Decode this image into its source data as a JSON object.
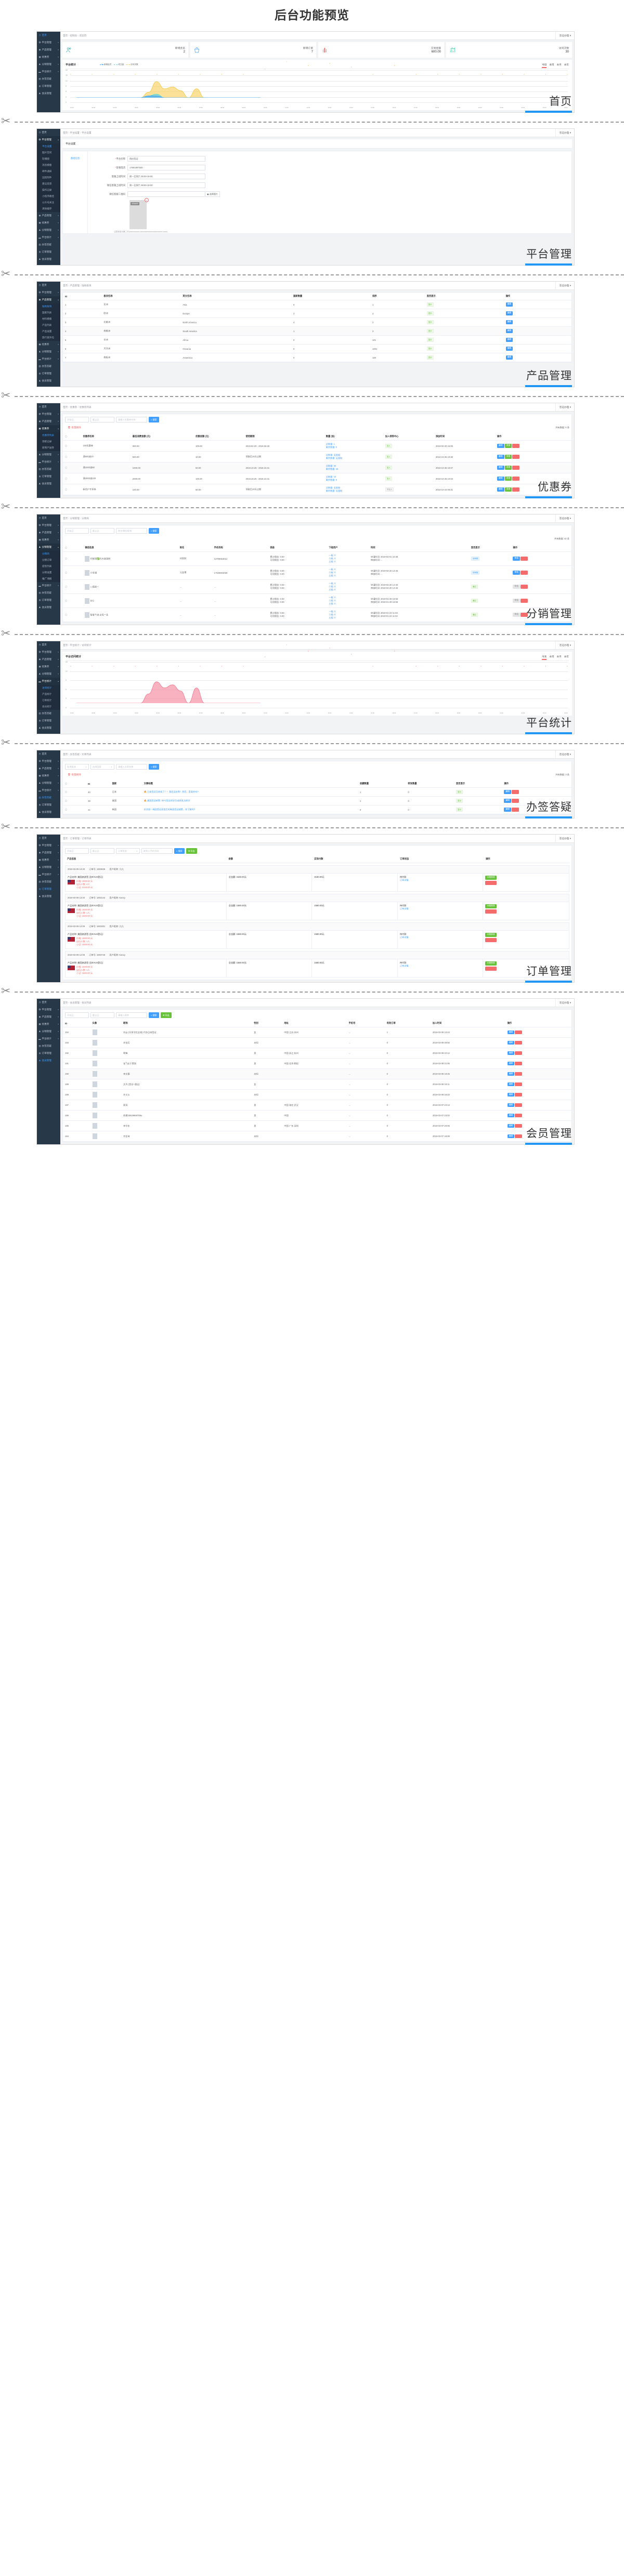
{
  "page": {
    "title": "后台功能预览"
  },
  "common": {
    "user_menu": "签证办理",
    "sidebar": [
      {
        "label": "首页",
        "icon": "dashboard-icon",
        "caret": ""
      },
      {
        "label": "平台管理",
        "icon": "gear-icon",
        "caret": "▾"
      },
      {
        "label": "产品管理",
        "icon": "globe-icon",
        "caret": "▾"
      },
      {
        "label": "优惠券",
        "icon": "ticket-icon",
        "caret": "▾"
      },
      {
        "label": "分销管理",
        "icon": "share-icon",
        "caret": "▾"
      },
      {
        "label": "平台统计",
        "icon": "monitor-icon",
        "caret": "▾"
      },
      {
        "label": "办签答疑",
        "icon": "book-icon",
        "caret": ""
      },
      {
        "label": "订单管理",
        "icon": "order-icon",
        "caret": ""
      },
      {
        "label": "会员管理",
        "icon": "user-icon",
        "caret": ""
      }
    ],
    "search_label": "搜索",
    "export_label": "导出",
    "edit_label": "编辑",
    "delete_label": "删除",
    "show_label": "显示",
    "start_date_ph": "开始日",
    "end_date_ph": "截止日"
  },
  "panels": [
    {
      "caption": "首页",
      "breadcrumb": [
        "首页",
        "控制台",
        "欢迎页"
      ],
      "stats": [
        {
          "label": "新增会员",
          "value": "2",
          "icon": "users-icon",
          "color": "#2bb7b3"
        },
        {
          "label": "新增订单",
          "value": "7",
          "icon": "bag-icon",
          "color": "#409eff"
        },
        {
          "label": "交易金额",
          "value": "600.00",
          "icon": "money-icon",
          "color": "#f56c6c"
        },
        {
          "label": "访问次数",
          "value": "30",
          "icon": "chart-up-icon",
          "color": "#2ecc9b"
        }
      ],
      "chart_title": "平台统计",
      "legend": [
        {
          "name": "新增会员",
          "color": "#409eff"
        },
        {
          "name": "成交量",
          "color": "#45d7e8"
        },
        {
          "name": "访问次数",
          "color": "#f5c842"
        }
      ],
      "tabs": [
        "今日",
        "本周",
        "本月",
        "本年"
      ],
      "active_tab": "今日"
    },
    {
      "caption": "平台管理",
      "breadcrumb": [
        "首页",
        "平台设置",
        "平台设置"
      ],
      "submenu": [
        "平台设置",
        "图片空间",
        "轮播图",
        "消息模版",
        "邮件通知",
        "远程附件",
        "建议反馈",
        "操作记录",
        "小程序路径",
        "公众号关注",
        "清除缓存"
      ],
      "submenu_selected": "平台设置",
      "card_title": "平台设置",
      "form_tab": "基础信息",
      "fields": [
        {
          "label": "平台名称",
          "value": "鸽应签证",
          "required": true
        },
        {
          "label": "客服电话",
          "value": "17681897500",
          "required": true
        },
        {
          "label": "客服上班时间",
          "value": "周一至周六 09:00-19:00",
          "required": false
        },
        {
          "label": "微信客服上班时间",
          "value": "周一至周六 09:00-19:00",
          "required": false
        },
        {
          "label": "微信客服二维码",
          "value": "",
          "required": false,
          "picker": "选择图片"
        }
      ],
      "thumb_size": "400x600",
      "hint": "注意状态为第二行(xxxxxxxxxxx.xxxxxxxxxxxxxxxxxxxxxxxx.com)"
    },
    {
      "caption": "产品管理",
      "breadcrumb": [
        "首页",
        "产品管理",
        "陆地板块"
      ],
      "submenu": [
        "陆地板块",
        "国家列表",
        "材料模版",
        "产品列表",
        "产品设置",
        "旅行意外险"
      ],
      "submenu_selected": "陆地板块",
      "columns": [
        "ID",
        "板块名称",
        "英文名称",
        "国家数量",
        "排序",
        "显否显示",
        "操作"
      ],
      "rows": [
        {
          "id": "1",
          "name": "亚洲",
          "en": "Asia",
          "count": "6",
          "sort": "1",
          "show": "显示",
          "action": "编辑"
        },
        {
          "id": "2",
          "name": "欧洲",
          "en": "Europe",
          "count": "3",
          "sort": "4",
          "show": "显示",
          "action": "编辑"
        },
        {
          "id": "3",
          "name": "北美洲",
          "en": "North America",
          "count": "4",
          "sort": "2",
          "show": "显示",
          "action": "编辑"
        },
        {
          "id": "4",
          "name": "南美洲",
          "en": "South America",
          "count": "1",
          "sort": "3",
          "show": "显示",
          "action": "编辑"
        },
        {
          "id": "5",
          "name": "非洲",
          "en": "Africa",
          "count": "0",
          "sort": "101",
          "show": "显示",
          "action": "编辑"
        },
        {
          "id": "6",
          "name": "大洋洲",
          "en": "Oceania",
          "count": "0",
          "sort": "1001",
          "show": "显示",
          "action": "编辑"
        },
        {
          "id": "7",
          "name": "南极洲",
          "en": "Antarctica",
          "count": "0",
          "sort": "100",
          "show": "显示",
          "action": "编辑"
        }
      ]
    },
    {
      "caption": "优惠券",
      "breadcrumb": [
        "首页",
        "优惠券",
        "优惠券列表"
      ],
      "submenu": [
        "优惠券列表",
        "领取记录",
        "新用户送券"
      ],
      "submenu_selected": "优惠券列表",
      "search_ph": "请输入优惠券名称",
      "batch_delete": "批量删除",
      "add": "添加",
      "count_text": "共有数据: 5 条",
      "columns": [
        "",
        "优惠券名称",
        "最低消费金额 (元)",
        "优惠金额 (元)",
        "使用期限",
        "数量 (张)",
        "加入领券中心",
        "添加时间",
        "操作"
      ],
      "rows": [
        {
          "name": "100优惠券",
          "min": "300.00",
          "amt": "100.00",
          "period": "2019.02.20 - 2019.02.28",
          "total": "总数量: 1",
          "left": "剩余数量: 0",
          "center": "加入",
          "center_type": "green",
          "time": "2019-02-20 15:06"
        },
        {
          "name": "满500减10",
          "min": "500.00",
          "amt": "10.00",
          "period": "领取后15天过期",
          "total": "总数量: 无限制",
          "left": "剩余数量: 无限制",
          "center": "加入",
          "center_type": "green",
          "time": "2018-10-25 10:38"
        },
        {
          "name": "满1000减50",
          "min": "1000.00",
          "amt": "50.00",
          "period": "2018.10.25 - 2018.10.31",
          "total": "总数量: 50",
          "left": "剩余数量: 46",
          "center": "加入",
          "center_type": "green",
          "time": "2018-10-25 10:37"
        },
        {
          "name": "满2000减100",
          "min": "2000.00",
          "amt": "100.00",
          "period": "2018.10.25 - 2018.10.31",
          "total": "总数量: 10",
          "left": "剩余数量: 9",
          "center": "加入",
          "center_type": "green",
          "time": "2018-10-25 10:03"
        },
        {
          "name": "新用户专享券",
          "min": "100.00",
          "amt": "50.00",
          "period": "领取后10天过期",
          "total": "总数量: 无限制",
          "left": "剩余数量: 无限制",
          "center": "不加入",
          "center_type": "grey",
          "time": "2018-10-24 09:31"
        }
      ],
      "actions": [
        "编辑",
        "发放",
        "删除"
      ]
    },
    {
      "caption": "分销管理",
      "breadcrumb": [
        "首页",
        "分销管理",
        "分销商"
      ],
      "submenu": [
        "分销商",
        "分销订单",
        "提现列表",
        "分销设置",
        "推广海报"
      ],
      "submenu_selected": "分销商",
      "search_ph": "姓名/微信昵称",
      "batch_pass": "批量通过",
      "count_text": "共有数据: 42 条",
      "columns": [
        "",
        "微信信息",
        "姓名",
        "手机号码",
        "佣金",
        "下级用户",
        "时间",
        "显否显示",
        "操作"
      ],
      "rows": [
        {
          "wx": "印家财✅光大旅游网",
          "name": "印家财",
          "phone": "13705915012",
          "c1": "累计佣金: 0.00",
          "c2": "可用佣金: 0.00",
          "l1": "一级: 0",
          "l2": "二级: 0",
          "l3": "三级: 0",
          "t1": "申请时间: 2019-03-01 22:38",
          "t2": "审核时间: ...",
          "status": "待审核",
          "status_type": "blue",
          "a1": "审核",
          "a1_type": "blue"
        },
        {
          "wx": "小幸福",
          "name": "亢宜博",
          "phone": "17625604059",
          "c1": "累计佣金: 0.00",
          "c2": "可用佣金: 0.00",
          "l1": "一级: 0",
          "l2": "二级: 0",
          "l3": "三级: 0",
          "t1": "申请时间: 2019-02-20 14:45",
          "t2": "审核时间: ...",
          "status": "待审核",
          "status_type": "blue",
          "a1": "审核",
          "a1_type": "blue"
        },
        {
          "wx": "い孤寂ヾ",
          "name": "...",
          "phone": "...",
          "c1": "累计佣金: 0.00",
          "c2": "可用佣金: 0.00",
          "l1": "一级: 0",
          "l2": "二级: 0",
          "l3": "三级: 0",
          "t1": "申请时间: 2019-02-20 14:40",
          "t2": "审核时间: 2019-02-20 14:40",
          "status": "通过",
          "status_type": "green",
          "a1": "审核",
          "a1_type": "grey"
        },
        {
          "wx": "BIG",
          "name": "...",
          "phone": "...",
          "c1": "累计佣金: 0.00",
          "c2": "可用佣金: 0.00",
          "l1": "一级: 0",
          "l2": "二级: 0",
          "l3": "三级: 0",
          "t1": "申请时间: 2019-01-29 16:56",
          "t2": "审核时间: 2019-01-29 16:56",
          "status": "通过",
          "status_type": "green",
          "a1": "审核",
          "a1_type": "grey"
        },
        {
          "wx": "智者千虑 必有一失",
          "name": "...",
          "phone": "...",
          "c1": "累计佣金: 0.00",
          "c2": "可用佣金: 0.00",
          "l1": "一级: 0",
          "l2": "二级: 0",
          "l3": "三级: 0",
          "t1": "申请时间: 2019-01-24 11:02",
          "t2": "审核时间: 2019-01-24 11:02",
          "status": "通过",
          "status_type": "green",
          "a1": "审核",
          "a1_type": "grey"
        }
      ]
    },
    {
      "caption": "平台统计",
      "breadcrumb": [
        "首页",
        "平台统计",
        "访问统计"
      ],
      "submenu": [
        "访问统计",
        "产品统计",
        "订单统计",
        "会员统计"
      ],
      "submenu_selected": "访问统计",
      "chart_title": "平台访问统计",
      "tabs": [
        "今天",
        "本周",
        "本月",
        "本年"
      ],
      "active_tab": "今天"
    },
    {
      "caption": "办签答疑",
      "breadcrumb": [
        "首页",
        "办签答疑",
        "文章列表"
      ],
      "select1": "陆地板块",
      "select2": "选择国家",
      "search_ph": "请输入文章名称",
      "batch_delete": "批量删除",
      "add": "添加文章",
      "count_text": "共有数据: 3 条",
      "columns": [
        "",
        "ID",
        "国家",
        "文章标题",
        "收藏数量",
        "转发数量",
        "显否显示",
        "操作"
      ],
      "rows": [
        {
          "id": "40",
          "country": "日本",
          "title": "日本签证又收紧了？！我还没去啊！然而，是真的吗?",
          "fav": "1",
          "fwd": "0",
          "hot": true
        },
        {
          "id": "39",
          "country": "美国",
          "title": "美国签证新策: 持F1签证的学生或将无法转学",
          "fav": "1",
          "fwd": "0",
          "hot": true
        },
        {
          "id": "41",
          "country": "韩国",
          "title": "好消息！韩国签证放宽后的韩国签证政策，你了解吗?",
          "fav": "0",
          "fwd": "0",
          "hot": false
        }
      ]
    },
    {
      "caption": "订单管理",
      "breadcrumb": [
        "首页",
        "订单管理",
        "订单列表"
      ],
      "status_ph": "订单状态",
      "phone_ph": "联系人手机号码",
      "columns": [
        "产品信息",
        "金额",
        "实际付款",
        "订单状态",
        "操作"
      ],
      "orders": [
        {
          "time": "2019-03-09 13:40",
          "no": "订单号: 1903826",
          "nick": "用户昵称: 亢亢",
          "product": "产品名称: 美国旅游签 (含EVUS登记)",
          "price": "价格: 1580.00 元",
          "people": "出行人数: 2人",
          "sub": "小记: 3160.00 元",
          "total": "总金额: 3160.00元",
          "paid": "3160.00元",
          "status": "待付款",
          "detail": "订单详情"
        },
        {
          "time": "2019-03-09 13:40",
          "no": "订单号: 1903144",
          "nick": "用户昵称: Kancy",
          "product": "产品名称: 美国旅游签 (含EVUS登记)",
          "price": "价格: 1580.00 元",
          "people": "出行人数: 1人",
          "sub": "小记: 1580.00 元",
          "total": "总金额: 1580.00元",
          "paid": "1580.00元",
          "status": "待付款",
          "detail": "订单详情"
        },
        {
          "time": "2019-03-09 12:09",
          "no": "订单号: 1903301",
          "nick": "用户昵称: 亢亢",
          "product": "产品名称: 美国旅游签 (含EVUS登记)",
          "price": "价格: 1580.00 元",
          "people": "出行人数: 1人",
          "sub": "小记: 1580.00 元",
          "total": "总金额: 1580.00元",
          "paid": "1580.00元",
          "status": "待付款",
          "detail": "订单详情"
        },
        {
          "time": "2019-03-09 12:06",
          "no": "订单号: 1903740",
          "nick": "用户昵称: Kancy",
          "product": "产品名称: 美国旅游签 (含EVUS登记)",
          "price": "价格: 1580.00 元",
          "people": "出行人数: 1人",
          "sub": "小记: 1580.00 元",
          "total": "总金额: 1580.00元",
          "paid": "1580.00元",
          "status": "待付款",
          "detail": "订单详情"
        }
      ],
      "actions": [
        "价格修改",
        "删除订单"
      ]
    },
    {
      "caption": "会员管理",
      "breadcrumb": [
        "首页",
        "会员管理",
        "会员列表"
      ],
      "search_ph": "请输入昵称",
      "columns": [
        "ID",
        "头像",
        "昵称",
        "性别",
        "地址",
        "手机号",
        "有效订单",
        "加入时间",
        "操作"
      ],
      "rows": [
        {
          "id": "194",
          "nick": "刘云 (乐享河北全线) 代办日本签证",
          "sex": "女",
          "addr": "中国 江苏 苏州",
          "phone": "...",
          "orders": "1",
          "time": "2019-03-09 10:44"
        },
        {
          "id": "193",
          "nick": "许宜芳",
          "sex": "未知",
          "addr": "",
          "phone": "...",
          "orders": "0",
          "time": "2019-03-09 09:50"
        },
        {
          "id": "192",
          "nick": "啊锋",
          "sex": "男",
          "addr": "中国 浙江 杭州",
          "phone": "...",
          "orders": "0",
          "time": "2019-03-08 22:12"
        },
        {
          "id": "191",
          "nick": "张飞长于策划",
          "sex": "男",
          "addr": "中国 北京 朝阳",
          "phone": "...",
          "orders": "0",
          "time": "2019-03-08 21:05"
        },
        {
          "id": "190",
          "nick": "李文慕",
          "sex": "未知",
          "addr": "",
          "phone": "...",
          "orders": "0",
          "time": "2019-03-08 19:45"
        },
        {
          "id": "189",
          "nick": "文丹 (签证+酒店)",
          "sex": "女",
          "addr": "",
          "phone": "...",
          "orders": "0",
          "time": "2019-03-08 18:11"
        },
        {
          "id": "188",
          "nick": "许义火",
          "sex": "未知",
          "addr": "",
          "phone": "...",
          "orders": "0",
          "time": "2019-03-08 16:03"
        },
        {
          "id": "187",
          "nick": "周涛",
          "sex": "男",
          "addr": "中国 湖北 武汉",
          "phone": "...",
          "orders": "0",
          "time": "2019-03-07 23:13"
        },
        {
          "id": "186",
          "nick": "徐建15629969785u",
          "sex": "男",
          "addr": "中国",
          "phone": "...",
          "orders": "0",
          "time": "2019-03-07 23:02"
        },
        {
          "id": "185",
          "nick": "李华东",
          "sex": "男",
          "addr": "中国 广东 深圳",
          "phone": "...",
          "orders": "0",
          "time": "2019-03-07 20:05"
        },
        {
          "id": "184",
          "nick": "齐亚琦",
          "sex": "未知",
          "addr": "",
          "phone": "...",
          "orders": "0",
          "time": "2019-03-07 18:09"
        }
      ]
    }
  ],
  "chart_data": [
    {
      "type": "area",
      "title": "平台统计",
      "xlabel": "",
      "ylabel": "",
      "ylim": [
        0,
        18
      ],
      "yticks": [
        0,
        3,
        6,
        9,
        12,
        15,
        18
      ],
      "categories": [
        "01:00",
        "02:00",
        "03:00",
        "04:00",
        "05:00",
        "06:00",
        "07:00",
        "08:00",
        "09:00",
        "10:00",
        "11:00",
        "12:00",
        "13:00",
        "14:00",
        "15:00",
        "16:00",
        "17:00",
        "18:00",
        "19:00",
        "20:00",
        "21:00",
        "22:00",
        "23:00",
        "24:00"
      ],
      "series": [
        {
          "name": "新增会员",
          "color": "#409eff",
          "values": [
            0,
            0,
            0,
            0,
            0,
            0,
            0,
            0,
            0,
            1,
            1,
            0,
            0,
            0,
            0,
            0,
            0,
            0,
            0,
            0,
            0,
            0,
            0,
            0
          ]
        },
        {
          "name": "成交量",
          "color": "#45d7e8",
          "values": [
            0,
            0,
            0,
            0,
            0,
            0,
            0,
            0,
            0,
            1,
            2,
            0,
            0,
            0,
            0,
            0,
            0,
            0,
            0,
            0,
            0,
            0,
            0,
            0
          ]
        },
        {
          "name": "访问次数",
          "color": "#f5c842",
          "values": [
            0,
            0,
            0,
            0,
            0,
            0,
            0,
            0,
            0,
            3,
            9,
            5,
            6,
            4,
            0,
            5,
            0,
            0,
            0,
            0,
            0,
            0,
            0,
            0
          ]
        }
      ],
      "point_labels": [
        "0",
        "0",
        "0",
        "0",
        "0",
        "0",
        "0",
        "0",
        "0",
        "3",
        "7",
        "5",
        "6",
        "4",
        "0",
        "5",
        "0",
        "0",
        "0",
        "0",
        "0",
        "0",
        "0",
        "0"
      ],
      "legend_position": "top-center",
      "grid": true
    },
    {
      "type": "area",
      "title": "平台访问统计",
      "xlabel": "",
      "ylabel": "",
      "ylim": [
        0,
        15
      ],
      "yticks": [
        0,
        3,
        6,
        9,
        12,
        15
      ],
      "categories": [
        "01:00",
        "02:00",
        "03:00",
        "04:00",
        "05:00",
        "06:00",
        "07:00",
        "08:00",
        "09:00",
        "10:00",
        "11:00",
        "12:00",
        "13:00",
        "14:00",
        "15:00",
        "16:00",
        "17:00",
        "18:00",
        "19:00",
        "20:00",
        "21:00",
        "22:00",
        "23:00",
        "24:00"
      ],
      "series": [
        {
          "name": "访问次数",
          "color": "#f4738a",
          "values": [
            0,
            0,
            0,
            0,
            0,
            0,
            0,
            0,
            0,
            3,
            7,
            5,
            6,
            4,
            0,
            5,
            0,
            0,
            0,
            0,
            0,
            0,
            0,
            0
          ]
        }
      ],
      "point_labels": [
        "0",
        "0",
        "0",
        "0",
        "0",
        "0",
        "0",
        "0",
        "0",
        "3",
        "7",
        "5",
        "6",
        "4",
        "0",
        "5",
        "0",
        "0",
        "0",
        "0",
        "0",
        "0",
        "0",
        "0"
      ],
      "legend_position": "none",
      "grid": true
    }
  ]
}
